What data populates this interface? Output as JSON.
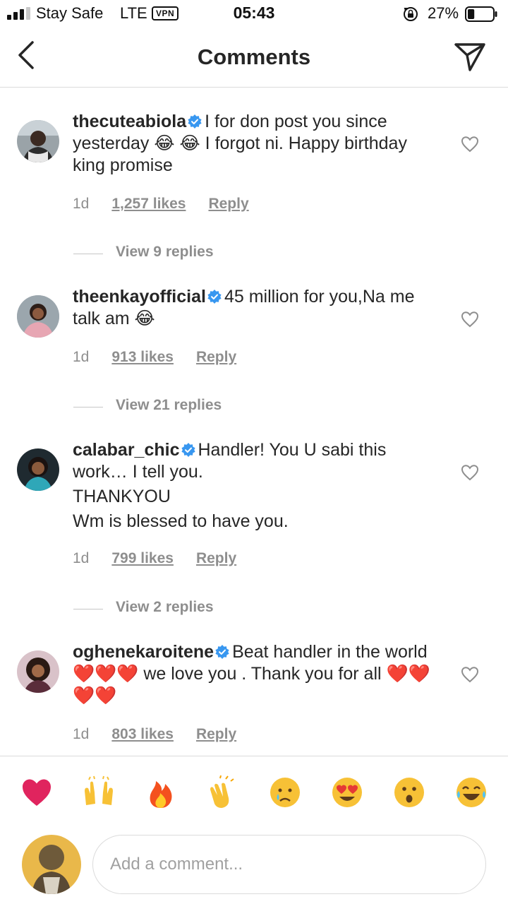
{
  "status_bar": {
    "carrier": "Stay Safe",
    "network": "LTE",
    "vpn": "VPN",
    "time": "05:43",
    "battery_percent": "27%",
    "battery_level": 0.27,
    "signal_bars": 3
  },
  "header": {
    "title": "Comments",
    "back_icon": "chevron-left-icon",
    "share_icon": "paper-plane-icon"
  },
  "comments": [
    {
      "username": "thecuteabiola",
      "text_parts": [
        "I for don post you since yesterday ",
        "😂",
        " ",
        "😂",
        " I forgot ni. Happy birthday king promise"
      ],
      "age": "1d",
      "likes": "1,257 likes",
      "reply": "Reply",
      "view_replies": "View 9 replies"
    },
    {
      "username": "theenkayofficial",
      "text_parts": [
        "45 million for you,Na me talk am ",
        "😂"
      ],
      "age": "1d",
      "likes": "913 likes",
      "reply": "Reply",
      "view_replies": "View 21 replies"
    },
    {
      "username": "calabar_chic",
      "text_parts": [
        "Handler! You U sabi this work… I tell you.",
        "THANKYOU",
        "Wm is blessed to have you."
      ],
      "age": "1d",
      "likes": "799 likes",
      "reply": "Reply",
      "view_replies": "View 2 replies"
    },
    {
      "username": "oghenekaroitene",
      "text_parts": [
        "Beat  handler in the world ",
        "❤️❤️❤️",
        "  we love you . Thank you for all ",
        "❤️❤️❤️❤️"
      ],
      "age": "1d",
      "likes": "803 likes",
      "reply": "Reply"
    }
  ],
  "reactions": [
    "❤️",
    "🙌",
    "🔥",
    "👏",
    "😢",
    "😍",
    "😮",
    "😂"
  ],
  "composer": {
    "placeholder": "Add a comment..."
  },
  "colors": {
    "text": "#262626",
    "muted": "#8e8e8e",
    "divider": "#dbdbdb",
    "verified": "#3897f0"
  }
}
